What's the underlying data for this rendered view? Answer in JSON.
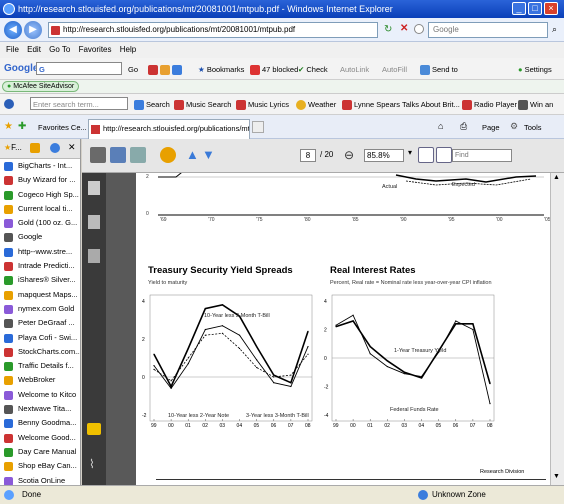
{
  "window": {
    "title": "http://research.stlouisfed.org/publications/mt/20081001/mtpub.pdf - Windows Internet Explorer"
  },
  "address": {
    "url": "http://research.stlouisfed.org/publications/mt/20081001/mtpub.pdf",
    "search_placeholder": "Google"
  },
  "menu": [
    "File",
    "Edit",
    "Go To",
    "Favorites",
    "Help"
  ],
  "google_toolbar": {
    "go": "Go",
    "bookmarks": "Bookmarks",
    "blocked": "47 blocked",
    "check": "Check",
    "autolink": "AutoLink",
    "autofill": "AutoFill",
    "send": "Send to",
    "settings": "Settings"
  },
  "mcafee": "McAfee SiteAdvisor",
  "search_toolbar": {
    "placeholder": "Enter search term...",
    "search": "Search",
    "music_search": "Music Search",
    "music_lyrics": "Music Lyrics",
    "weather": "Weather",
    "news": "Lynne Spears Talks About Brit...",
    "radio": "Radio Player",
    "win": "Win an"
  },
  "favbar": {
    "favorites": "Favorites Ce...",
    "tab": "http://research.stlouisfed.org/publications/mt/20081...",
    "page": "Page",
    "tools": "Tools"
  },
  "sidebar_items": [
    "BigCharts - Int...",
    "Buy Wizard for ...",
    "Cogeco High Sp...",
    "Current local ti...",
    "Gold (100 oz. G...",
    "Google",
    "http--www.stre...",
    "Intrade Predicti...",
    "iShares® Silver...",
    "mapquest Maps...",
    "nymex.com Gold",
    "Peter DeGraaf ...",
    "Playa Cofi - Swi...",
    "StockCharts.com...",
    "Traffic Details f...",
    "WebBroker",
    "Welcome to Kitco",
    "Nextwave Tita...",
    "Benny Goodma...",
    "Welcome Good...",
    "Day Care Manual",
    "Shop eBay Can...",
    "Scotia OnLine",
    "TMQ.com Excha..."
  ],
  "pdf_toolbar": {
    "page": "8",
    "total": "/ 20",
    "zoom": "85.8%",
    "find": "Find"
  },
  "top_chart": {
    "actual": "Actual",
    "expected": "Expected",
    "years": [
      "'69",
      "'70",
      "'75",
      "'80",
      "'85",
      "'90",
      "'95",
      "'00",
      "'05"
    ]
  },
  "chart1": {
    "title": "Treasury Security Yield Spreads",
    "subtitle": "Yield to maturity",
    "label_a": "10-Year less 3-Month T-Bill",
    "label_b": "10-Year less 2-Year Note",
    "label_c": "3-Year less 3-Month T-Bill",
    "years": [
      "99",
      "00",
      "01",
      "02",
      "03",
      "04",
      "05",
      "06",
      "07",
      "08"
    ],
    "yticks": [
      "4",
      "2",
      "0",
      "-2"
    ]
  },
  "chart2": {
    "title": "Real Interest Rates",
    "subtitle": "Percent, Real rate = Nominal rate less year-over-year CPI inflation",
    "label_a": "1-Year Treasury Yield",
    "label_b": "Federal Funds Rate",
    "years": [
      "99",
      "00",
      "01",
      "02",
      "03",
      "04",
      "05",
      "06",
      "07",
      "08"
    ],
    "yticks": [
      "4",
      "2",
      "0",
      "-2",
      "-4"
    ]
  },
  "footer": "Research Division",
  "status": {
    "left": "Done",
    "zone": "Unknown Zone"
  },
  "chart_data": [
    {
      "type": "line",
      "title": "Treasury Security Yield Spreads",
      "ylabel": "Yield to maturity",
      "ylim": [
        -2,
        4
      ],
      "x": [
        "99",
        "00",
        "01",
        "02",
        "03",
        "04",
        "05",
        "06",
        "07",
        "08"
      ],
      "series": [
        {
          "name": "10-Year less 3-Month T-Bill",
          "values": [
            1.2,
            -0.5,
            1.5,
            3.6,
            3.8,
            3.2,
            1.6,
            0.1,
            -0.3,
            2.4
          ]
        },
        {
          "name": "10-Year less 2-Year Note",
          "values": [
            0.4,
            -0.2,
            1.0,
            2.2,
            2.3,
            1.5,
            0.5,
            0.0,
            0.1,
            1.2
          ]
        },
        {
          "name": "3-Year less 3-Month T-Bill",
          "values": [
            0.6,
            -0.6,
            0.7,
            2.5,
            2.7,
            2.2,
            0.9,
            -0.3,
            -0.5,
            1.6
          ]
        }
      ]
    },
    {
      "type": "line",
      "title": "Real Interest Rates",
      "ylabel": "Percent, Real rate = Nominal rate less year-over-year CPI inflation",
      "ylim": [
        -4,
        4
      ],
      "x": [
        "99",
        "00",
        "01",
        "02",
        "03",
        "04",
        "05",
        "06",
        "07",
        "08"
      ],
      "series": [
        {
          "name": "1-Year Treasury Yield",
          "values": [
            2.2,
            2.6,
            0.8,
            -0.2,
            -1.0,
            -1.4,
            0.5,
            2.4,
            2.4,
            -1.8
          ]
        },
        {
          "name": "Federal Funds Rate",
          "values": [
            2.3,
            3.0,
            0.3,
            -0.6,
            -1.1,
            -1.3,
            0.4,
            2.6,
            2.0,
            -3.2
          ]
        }
      ]
    }
  ]
}
